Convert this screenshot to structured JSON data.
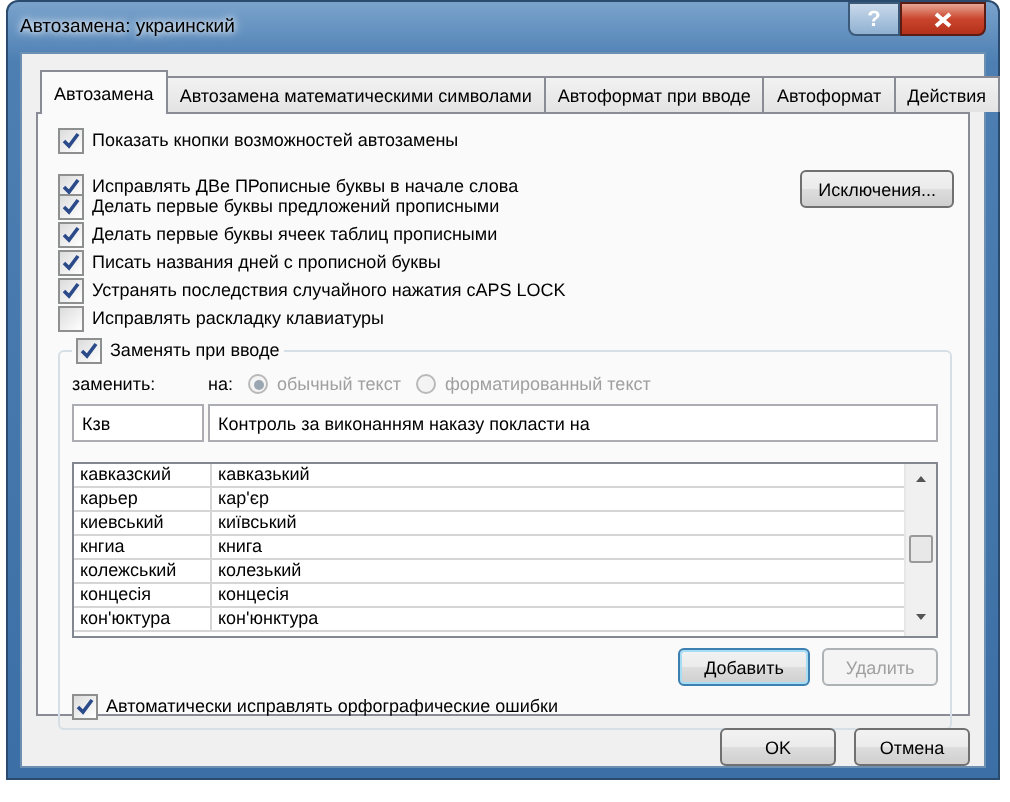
{
  "window": {
    "title": "Автозамена: украинский",
    "help_button": "?"
  },
  "tabs": [
    {
      "label": "Автозамена",
      "selected": true
    },
    {
      "label": "Автозамена математическими символами",
      "selected": false
    },
    {
      "label": "Автоформат при вводе",
      "selected": false
    },
    {
      "label": "Автоформат",
      "selected": false
    },
    {
      "label": "Действия",
      "selected": false
    }
  ],
  "options": [
    {
      "label": "Показать кнопки возможностей автозамены",
      "checked": true
    },
    {
      "label": "Исправлять ДВе ПРописные буквы в начале слова",
      "checked": true
    },
    {
      "label": "Делать первые буквы предложений прописными",
      "checked": true
    },
    {
      "label": "Делать первые буквы ячеек таблиц прописными",
      "checked": true
    },
    {
      "label": "Писать названия дней с прописной буквы",
      "checked": true
    },
    {
      "label": "Устранять последствия случайного нажатия cAPS LOCK",
      "checked": true
    },
    {
      "label": "Исправлять раскладку клавиатуры",
      "checked": false
    }
  ],
  "exceptions_button": "Исключения...",
  "replace_group": {
    "label": "Заменять при вводе",
    "checked": true,
    "replace_label": "заменить:",
    "with_label": "на:",
    "formats": [
      {
        "label": "обычный текст",
        "selected": true,
        "disabled": true
      },
      {
        "label": "форматированный текст",
        "selected": false,
        "disabled": true
      }
    ],
    "replace_value": "Кзв",
    "with_value": "Контроль за виконанням наказу покласти на",
    "table": {
      "rows": [
        [
          "кавказский",
          "кавказький"
        ],
        [
          "карьер",
          "кар'єр"
        ],
        [
          "киевський",
          "київський"
        ],
        [
          "кнгиа",
          "книга"
        ],
        [
          "колежський",
          "колезький"
        ],
        [
          "концесія",
          "концесія"
        ],
        [
          "кон'юктура",
          "кон'юнктура"
        ]
      ]
    },
    "add_button": {
      "label": "Добавить",
      "disabled": false
    },
    "delete_button": {
      "label": "Удалить",
      "disabled": true
    }
  },
  "spelling_option": {
    "label": "Автоматически исправлять орфографические ошибки",
    "checked": true
  },
  "buttons": [
    "OK",
    "Отмена"
  ]
}
